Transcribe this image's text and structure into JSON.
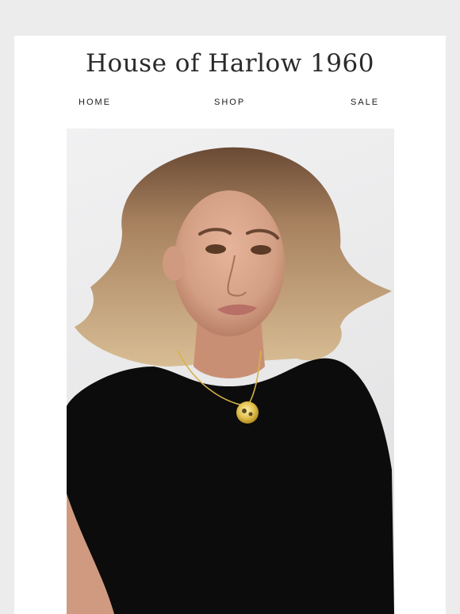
{
  "brand": {
    "logo_text": "House of Harlow 1960"
  },
  "nav": {
    "items": [
      {
        "label": "HOME"
      },
      {
        "label": "SHOP"
      },
      {
        "label": "SALE"
      }
    ]
  },
  "hero": {
    "image_subject": "portrait-photo",
    "colors": {
      "background": "#ececed",
      "card": "#ffffff",
      "text": "#1a1a1a"
    }
  }
}
